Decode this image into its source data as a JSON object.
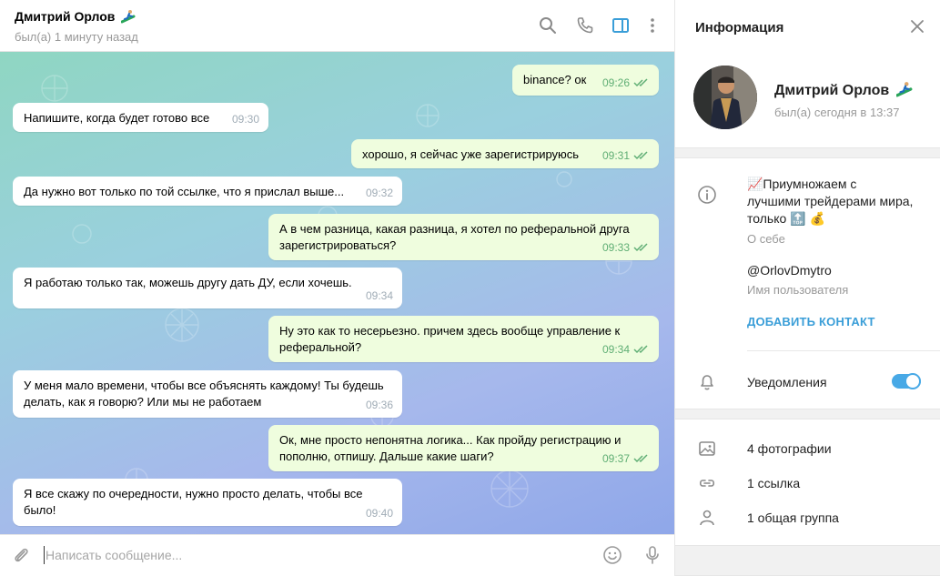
{
  "chat_header": {
    "name": "Дмитрий Орлов",
    "status": "был(а) 1 минуту назад"
  },
  "messages": [
    {
      "dir": "out",
      "text": "binance? ок",
      "time": "09:26"
    },
    {
      "dir": "in",
      "text": "Напишите, когда будет готово все",
      "time": "09:30"
    },
    {
      "dir": "out",
      "text": "хорошо, я сейчас уже зарегистрируюсь",
      "time": "09:31"
    },
    {
      "dir": "in",
      "text": "Да нужно вот только по той ссылке, что я прислал выше...",
      "time": "09:32"
    },
    {
      "dir": "out",
      "text": "А в чем разница, какая разница, я хотел по реферальной друга зарегистрироваться?",
      "time": "09:33"
    },
    {
      "dir": "in",
      "text": "Я работаю только так, можешь другу дать ДУ, если хочешь.",
      "time": "09:34"
    },
    {
      "dir": "out",
      "text": "Ну это как то несерьезно. причем здесь вообще управление к реферальной?",
      "time": "09:34"
    },
    {
      "dir": "in",
      "text": "У меня мало времени, чтобы все объяснять каждому! Ты будешь делать, как я говорю? Или мы не работаем",
      "time": "09:36"
    },
    {
      "dir": "out",
      "text": "Ок, мне просто непонятна логика... Как пройду регистрацию и пополню, отпишу. Дальше какие шаги?",
      "time": "09:37"
    },
    {
      "dir": "in",
      "text": "Я все скажу по очередности, нужно просто делать, чтобы все было!",
      "time": "09:40"
    }
  ],
  "composer": {
    "placeholder": "Написать сообщение..."
  },
  "info_panel": {
    "title": "Информация",
    "name": "Дмитрий Орлов",
    "last_seen": "был(а) сегодня в 13:37",
    "bio_line1": "📈Приумножаем с",
    "bio_line2": "лучшими трейдерами мира,",
    "bio_line3": "только 🔝 💰",
    "bio_label": "О себе",
    "username": "@OrlovDmytro",
    "username_label": "Имя пользователя",
    "add_contact": "ДОБАВИТЬ КОНТАКТ",
    "notifications_label": "Уведомления",
    "notifications_on": true,
    "photos": "4 фотографии",
    "links": "1 ссылка",
    "groups": "1 общая группа"
  },
  "colors": {
    "accent": "#48a9e6",
    "outgoing_bubble": "#effdde",
    "incoming_bubble": "#ffffff",
    "read_checks": "#5fae74"
  },
  "icons": [
    "surfer-emoji-icon",
    "search-icon",
    "phone-icon",
    "sidebar-toggle-icon",
    "more-vertical-icon",
    "attach-icon",
    "emoji-icon",
    "microphone-icon",
    "close-icon",
    "info-icon",
    "bell-icon",
    "photo-icon",
    "link-icon",
    "group-icon",
    "double-check-icon"
  ]
}
